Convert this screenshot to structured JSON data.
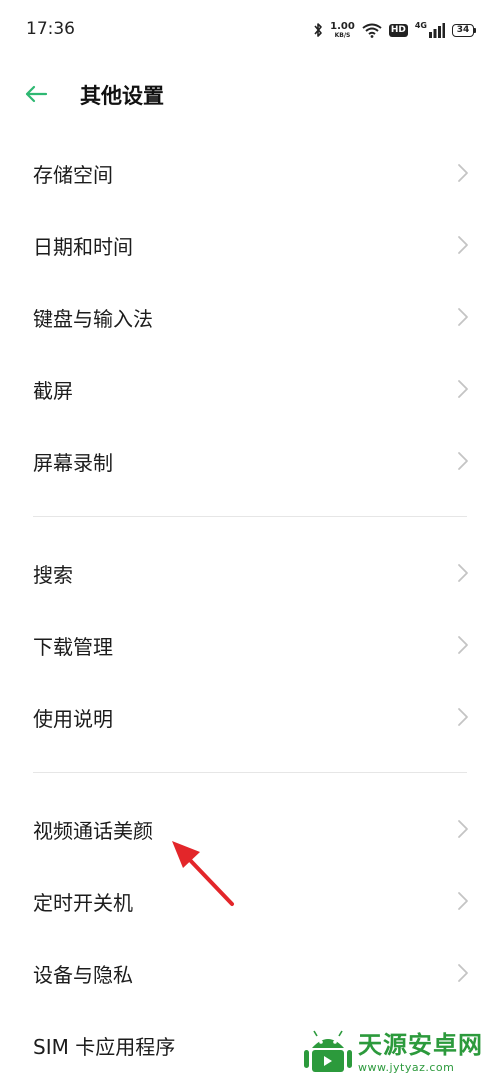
{
  "status_bar": {
    "time": "17:36",
    "speed_value": "1.00",
    "speed_unit": "KB/S",
    "hd": "HD",
    "network": "4G",
    "battery": "34"
  },
  "header": {
    "title": "其他设置"
  },
  "groups": [
    {
      "items": [
        {
          "label": "存储空间"
        },
        {
          "label": "日期和时间"
        },
        {
          "label": "键盘与输入法"
        },
        {
          "label": "截屏"
        },
        {
          "label": "屏幕录制"
        }
      ]
    },
    {
      "items": [
        {
          "label": "搜索"
        },
        {
          "label": "下载管理"
        },
        {
          "label": "使用说明"
        }
      ]
    },
    {
      "items": [
        {
          "label": "视频通话美颜"
        },
        {
          "label": "定时开关机"
        },
        {
          "label": "设备与隐私"
        },
        {
          "label": "SIM 卡应用程序"
        }
      ]
    }
  ],
  "watermark": {
    "title": "天源安卓网",
    "url": "www.jytyaz.com"
  },
  "colors": {
    "accent": "#2eb872",
    "annotation": "#e3262a",
    "watermark": "#2c9a3c"
  }
}
